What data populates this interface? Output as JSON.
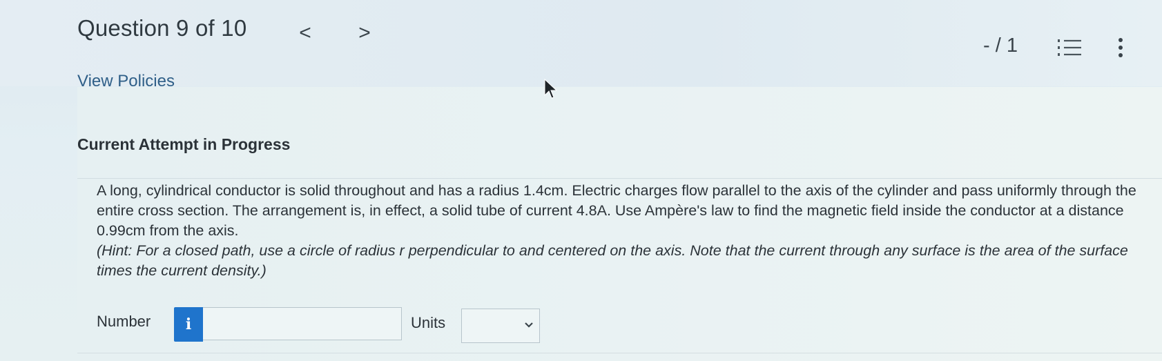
{
  "header": {
    "question_counter": "Question 9 of 10",
    "prev_glyph": "<",
    "next_glyph": ">",
    "score": "- / 1",
    "list_icon": "numbered-list-icon",
    "menu_icon": "kebab-menu-icon"
  },
  "links": {
    "view_policies": "View Policies"
  },
  "main": {
    "attempt_heading": "Current Attempt in Progress",
    "question_text": "A long, cylindrical conductor is solid throughout and has a radius 1.4cm. Electric charges flow parallel to the axis of the cylinder and pass uniformly through the entire cross section. The arrangement is, in effect, a solid tube of current 4.8A. Use Ampère's law to find the magnetic field inside the conductor at a distance 0.99cm from the axis.",
    "hint_text": "(Hint: For a closed path, use a circle of radius r perpendicular to and centered on the axis. Note that the current through any surface is the area of the surface times the current density.)"
  },
  "answer": {
    "number_label": "Number",
    "info_glyph": "i",
    "number_value": "",
    "units_label": "Units",
    "units_selected": ""
  },
  "colors": {
    "accent_blue": "#1f74cc",
    "link_blue": "#2f5f88",
    "text": "#2b3238"
  }
}
